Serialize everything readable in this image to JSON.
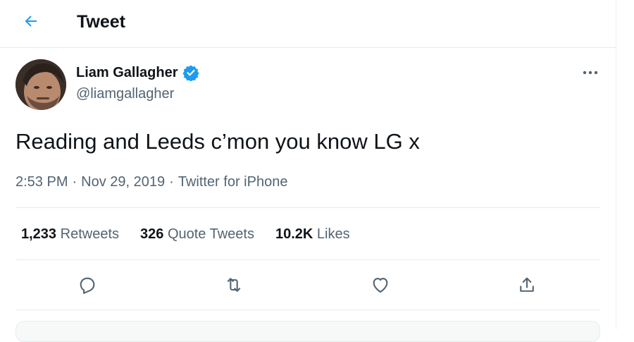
{
  "colors": {
    "accent": "#1d9bf0",
    "text_primary": "#0f1419",
    "text_secondary": "#536471",
    "divider": "#e6ecf0"
  },
  "header": {
    "back_icon": "arrow-left-icon",
    "title": "Tweet"
  },
  "tweet": {
    "author": {
      "name": "Liam Gallagher",
      "handle": "@liamgallagher",
      "verified": true,
      "verified_icon": "verified-badge-icon"
    },
    "more_icon": "more-dots-icon",
    "text": "Reading and Leeds c’mon you know LG x",
    "meta": {
      "time": "2:53 PM",
      "date": "Nov 29, 2019",
      "source": "Twitter for iPhone",
      "separator": "·"
    },
    "stats": [
      {
        "value": "1,233",
        "label": "Retweets"
      },
      {
        "value": "326",
        "label": "Quote Tweets"
      },
      {
        "value": "10.2K",
        "label": "Likes"
      }
    ],
    "actions": [
      {
        "name": "reply",
        "icon": "reply-icon"
      },
      {
        "name": "retweet",
        "icon": "retweet-icon"
      },
      {
        "name": "like",
        "icon": "heart-icon"
      },
      {
        "name": "share",
        "icon": "share-icon"
      }
    ]
  }
}
